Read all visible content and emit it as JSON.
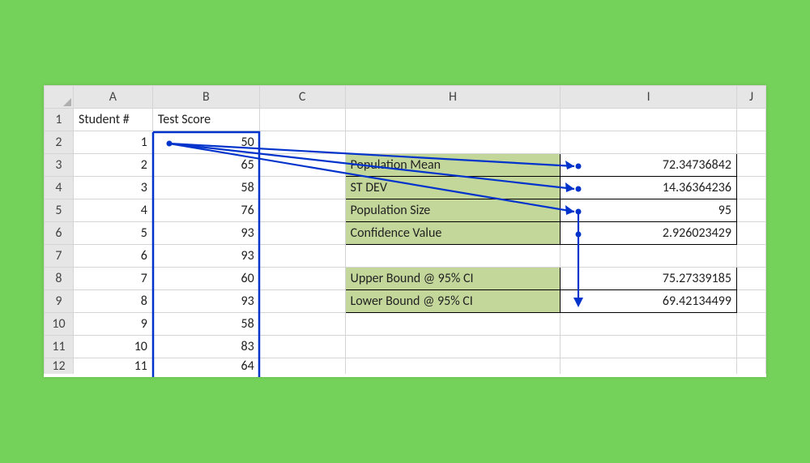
{
  "columns": {
    "A": "A",
    "B": "B",
    "C": "C",
    "H": "H",
    "I": "I",
    "J": "J"
  },
  "rowNums": [
    "1",
    "2",
    "3",
    "4",
    "5",
    "6",
    "7",
    "8",
    "9",
    "10",
    "11",
    "12"
  ],
  "headers": {
    "studentNum": "Student #",
    "testScore": "Test Score"
  },
  "students": {
    "ids": [
      "1",
      "2",
      "3",
      "4",
      "5",
      "6",
      "7",
      "8",
      "9",
      "10",
      "11"
    ],
    "scores": [
      "50",
      "65",
      "58",
      "76",
      "93",
      "93",
      "60",
      "93",
      "58",
      "83",
      "64"
    ]
  },
  "stats": {
    "popMeanLabel": "Population Mean",
    "popMean": "72.34736842",
    "stDevLabel": "ST DEV",
    "stDev": "14.36364236",
    "popSizeLabel": "Population Size",
    "popSize": "95",
    "confValLabel": "Confidence Value",
    "confVal": "2.926023429",
    "upperLabel": "Upper Bound @ 95% CI",
    "upper": "75.27339185",
    "lowerLabel": "Lower Bound @ 95% CI",
    "lower": "69.42134499"
  }
}
